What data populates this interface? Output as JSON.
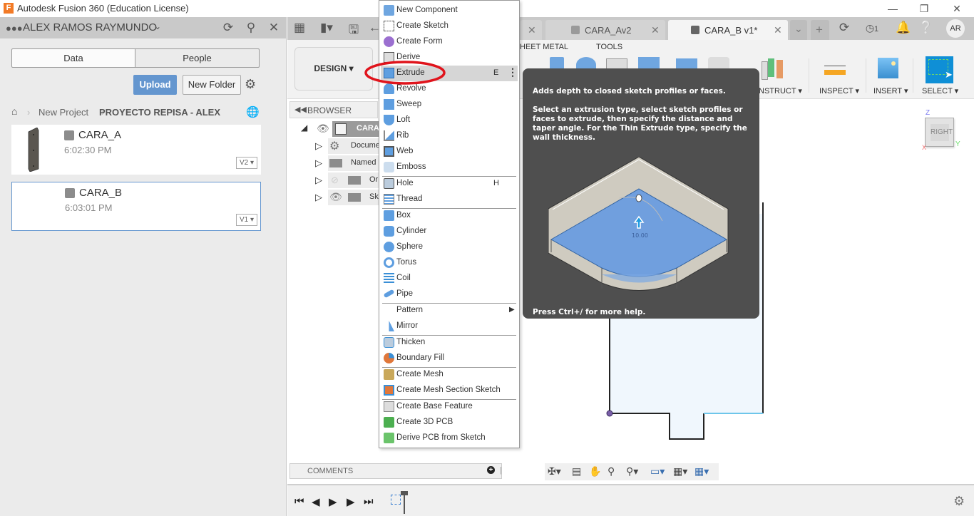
{
  "window": {
    "title": "Autodesk Fusion 360 (Education License)",
    "logo_letter": "F",
    "minimize_icon": "—",
    "restore_icon": "❐",
    "close_icon": "✕"
  },
  "data_panel": {
    "user_name": "ALEX RAMOS RAYMUNDO",
    "tabs": [
      "Data",
      "People"
    ],
    "upload_label": "Upload",
    "new_folder_label": "New Folder",
    "breadcrumb": [
      "New Project",
      "PROYECTO REPISA - ALEX"
    ],
    "files": [
      {
        "name": "CARA_A",
        "time": "6:02:30 PM",
        "version": "V2"
      },
      {
        "name": "CARA_B",
        "time": "6:03:01 PM",
        "version": "V1"
      }
    ]
  },
  "doc_tabs": [
    {
      "name": "CARA_Av2",
      "active": false
    },
    {
      "name": "CARA_B v1*",
      "active": true
    }
  ],
  "toolbar": {
    "jobs_count": "1",
    "avatar_initials": "AR"
  },
  "ribbon": {
    "workspace": "DESIGN",
    "tabs": [
      "HEET METAL",
      "TOOLS"
    ],
    "groups": [
      "NSTRUCT",
      "INSPECT",
      "INSERT",
      "SELECT"
    ]
  },
  "browser": {
    "title": "BROWSER",
    "root": "CARA",
    "items": [
      "Docume",
      "Named ",
      "Or",
      "Sk"
    ]
  },
  "create_menu": {
    "items": [
      {
        "label": "New Component",
        "icon": "new-component"
      },
      {
        "label": "Create Sketch",
        "icon": "create-sketch"
      },
      {
        "label": "Create Form",
        "icon": "create-form"
      },
      {
        "label": "Derive",
        "icon": "derive"
      },
      {
        "label": "Extrude",
        "icon": "extrude",
        "shortcut": "E",
        "highlighted": true
      },
      {
        "label": "Revolve",
        "icon": "revolve"
      },
      {
        "label": "Sweep",
        "icon": "sweep"
      },
      {
        "label": "Loft",
        "icon": "loft"
      },
      {
        "label": "Rib",
        "icon": "rib"
      },
      {
        "label": "Web",
        "icon": "web"
      },
      {
        "label": "Emboss",
        "icon": "emboss"
      },
      {
        "label": "Hole",
        "icon": "hole",
        "shortcut": "H"
      },
      {
        "label": "Thread",
        "icon": "thread"
      },
      {
        "label": "Box",
        "icon": "box"
      },
      {
        "label": "Cylinder",
        "icon": "cylinder"
      },
      {
        "label": "Sphere",
        "icon": "sphere"
      },
      {
        "label": "Torus",
        "icon": "torus"
      },
      {
        "label": "Coil",
        "icon": "coil"
      },
      {
        "label": "Pipe",
        "icon": "pipe"
      },
      {
        "label": "Pattern",
        "icon": "",
        "submenu": true
      },
      {
        "label": "Mirror",
        "icon": "mirror"
      },
      {
        "label": "Thicken",
        "icon": "thicken"
      },
      {
        "label": "Boundary Fill",
        "icon": "boundary-fill"
      },
      {
        "label": "Create Mesh",
        "icon": "create-mesh"
      },
      {
        "label": "Create Mesh Section Sketch",
        "icon": "mesh-section"
      },
      {
        "label": "Create Base Feature",
        "icon": "base-feature"
      },
      {
        "label": "Create 3D PCB",
        "icon": "3d-pcb"
      },
      {
        "label": "Derive PCB from Sketch",
        "icon": "derive-pcb"
      }
    ]
  },
  "tooltip": {
    "summary": "Adds depth to closed sketch profiles or faces.",
    "detail": "Select an extrusion type, select sketch profiles or faces to extrude, then specify the distance and taper angle. For the Thin Extrude type, specify the wall thickness.",
    "illustration_dimension": "10.00",
    "footer": "Press Ctrl+/ for more help."
  },
  "viewcube": {
    "face": "RIGHT",
    "axes": [
      "Z",
      "Y",
      "X"
    ]
  },
  "comments": {
    "label": "COMMENTS"
  },
  "colors": {
    "accent_blue": "#6496cf",
    "select_blue": "#0f8fd6",
    "annotation_red": "#e0141c",
    "tooltip_bg": "#4f4f4f"
  }
}
